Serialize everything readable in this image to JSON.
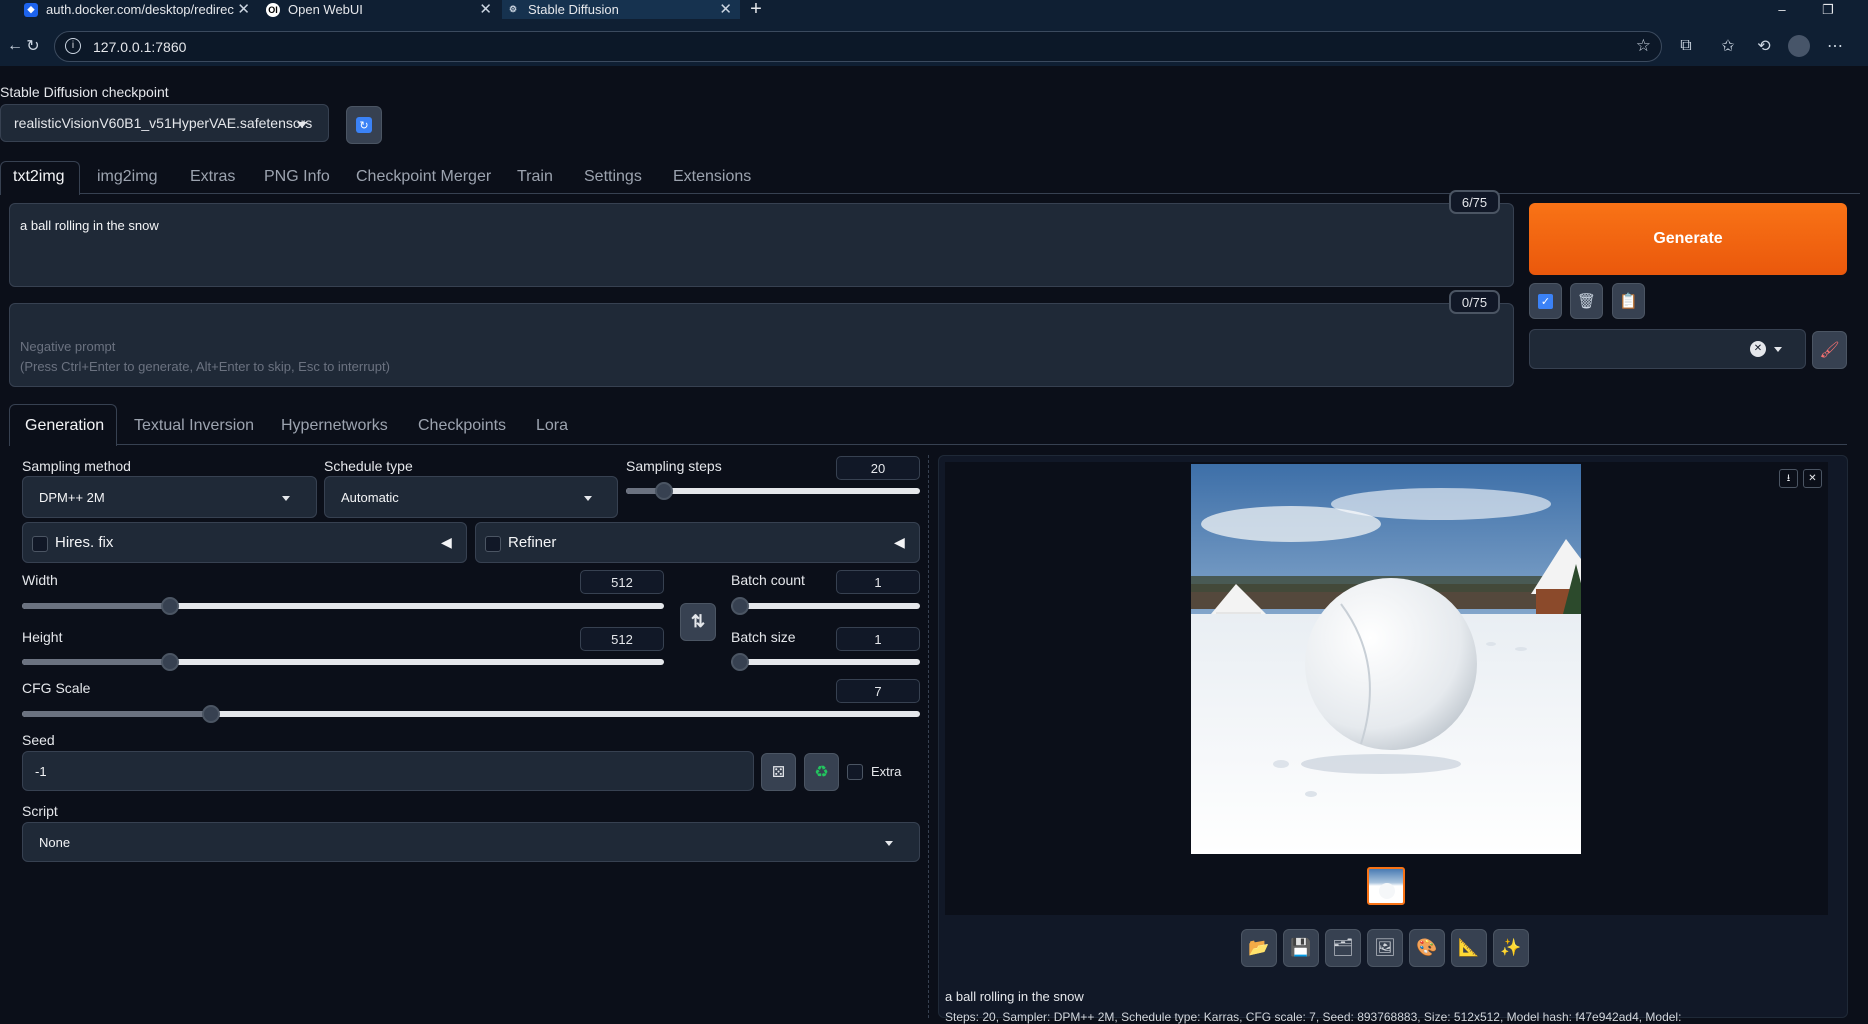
{
  "browser": {
    "tabs": [
      {
        "title": "auth.docker.com/desktop/redirec"
      },
      {
        "title": "Open WebUI"
      },
      {
        "title": "Stable Diffusion"
      }
    ],
    "url": "127.0.0.1:7860"
  },
  "checkpoint": {
    "label": "Stable Diffusion checkpoint",
    "value": "realisticVisionV60B1_v51HyperVAE.safetensors"
  },
  "main_tabs": [
    "txt2img",
    "img2img",
    "Extras",
    "PNG Info",
    "Checkpoint Merger",
    "Train",
    "Settings",
    "Extensions"
  ],
  "prompt": {
    "text": "a ball rolling in the snow",
    "token_count": "6/75"
  },
  "negative_prompt": {
    "placeholder": "Negative prompt\n(Press Ctrl+Enter to generate, Alt+Enter to skip, Esc to interrupt)",
    "token_count": "0/75"
  },
  "generate_label": "Generate",
  "sub_tabs": [
    "Generation",
    "Textual Inversion",
    "Hypernetworks",
    "Checkpoints",
    "Lora"
  ],
  "settings": {
    "sampling_method": {
      "label": "Sampling method",
      "value": "DPM++ 2M"
    },
    "schedule_type": {
      "label": "Schedule type",
      "value": "Automatic"
    },
    "sampling_steps": {
      "label": "Sampling steps",
      "value": "20",
      "fraction": 0.13
    },
    "hires_fix": {
      "label": "Hires. fix"
    },
    "refiner": {
      "label": "Refiner"
    },
    "width": {
      "label": "Width",
      "value": "512",
      "fraction": 0.23
    },
    "height": {
      "label": "Height",
      "value": "512",
      "fraction": 0.23
    },
    "batch_count": {
      "label": "Batch count",
      "value": "1",
      "fraction": 0.0
    },
    "batch_size": {
      "label": "Batch size",
      "value": "1",
      "fraction": 0.0
    },
    "cfg_scale": {
      "label": "CFG Scale",
      "value": "7",
      "fraction": 0.21
    },
    "seed": {
      "label": "Seed",
      "value": "-1"
    },
    "extra_label": "Extra",
    "script": {
      "label": "Script",
      "value": "None"
    }
  },
  "output": {
    "caption": "a ball rolling in the snow",
    "info": "Steps: 20, Sampler: DPM++ 2M, Schedule type: Karras, CFG scale: 7, Seed: 893768883, Size: 512x512, Model hash: f47e942ad4, Model:"
  },
  "colors": {
    "accent": "#ea580c",
    "background": "#0b0f19",
    "panel": "#1f2937"
  }
}
